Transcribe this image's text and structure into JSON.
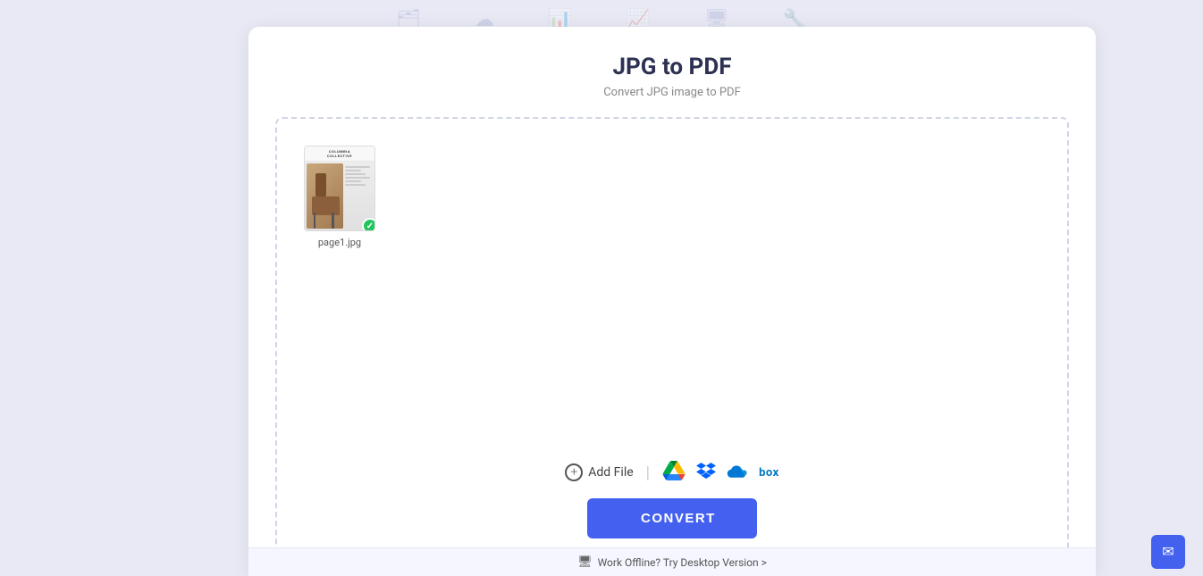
{
  "page": {
    "title": "JPG to PDF",
    "subtitle": "Convert JPG image to PDF",
    "background_color": "#e8e9f5"
  },
  "dropzone": {
    "border_color": "#d0d4e8"
  },
  "file": {
    "name": "page1.jpg",
    "has_check": true
  },
  "actions": {
    "add_file_label": "Add File",
    "convert_label": "CONVERT",
    "offline_label": "Work Offline? Try Desktop Version >"
  },
  "cloud_services": {
    "google_drive": "Google Drive",
    "dropbox": "Dropbox",
    "onedrive": "OneDrive",
    "box": "box"
  },
  "email_button": {
    "label": "✉"
  }
}
